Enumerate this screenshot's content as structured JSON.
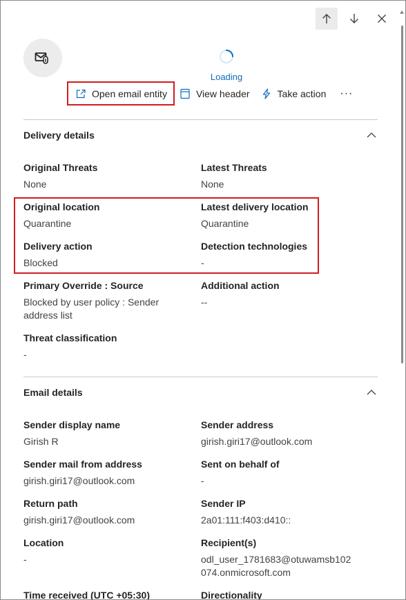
{
  "nav": {
    "up_icon": "arrow-up-icon",
    "down_icon": "arrow-down-icon",
    "close_icon": "close-icon"
  },
  "avatar": {
    "icon": "email-attachment-icon"
  },
  "loading": {
    "label": "Loading"
  },
  "toolbar": {
    "open_email_entity": "Open email entity",
    "view_header": "View header",
    "take_action": "Take action",
    "more": "···"
  },
  "delivery_details": {
    "title": "Delivery details",
    "fields": [
      {
        "label": "Original Threats",
        "value": "None"
      },
      {
        "label": "Latest Threats",
        "value": "None"
      },
      {
        "label": "Original location",
        "value": "Quarantine"
      },
      {
        "label": "Latest delivery location",
        "value": "Quarantine"
      },
      {
        "label": "Delivery action",
        "value": "Blocked"
      },
      {
        "label": "Detection technologies",
        "value": "-"
      },
      {
        "label": "Primary Override : Source",
        "value": "Blocked by user policy : Sender address list"
      },
      {
        "label": "Additional action",
        "value": "--"
      },
      {
        "label": "Threat classification",
        "value": "-"
      }
    ]
  },
  "email_details": {
    "title": "Email details",
    "fields": [
      {
        "label": "Sender display name",
        "value": "Girish R"
      },
      {
        "label": "Sender address",
        "value": "girish.giri17@outlook.com"
      },
      {
        "label": "Sender mail from address",
        "value": "girish.giri17@outlook.com"
      },
      {
        "label": "Sent on behalf of",
        "value": "-"
      },
      {
        "label": "Return path",
        "value": "girish.giri17@outlook.com"
      },
      {
        "label": "Sender IP",
        "value": "2a01:111:f403:d410::"
      },
      {
        "label": "Location",
        "value": "-"
      },
      {
        "label": "Recipient(s)",
        "value": "odl_user_1781683@otuwamsb102074.onmicrosoft.com"
      },
      {
        "label": "Time received (UTC +05:30)",
        "value": ""
      },
      {
        "label": "Directionality",
        "value": ""
      }
    ]
  },
  "colors": {
    "accent": "#0f6cbd",
    "highlight": "#d01c1c"
  }
}
